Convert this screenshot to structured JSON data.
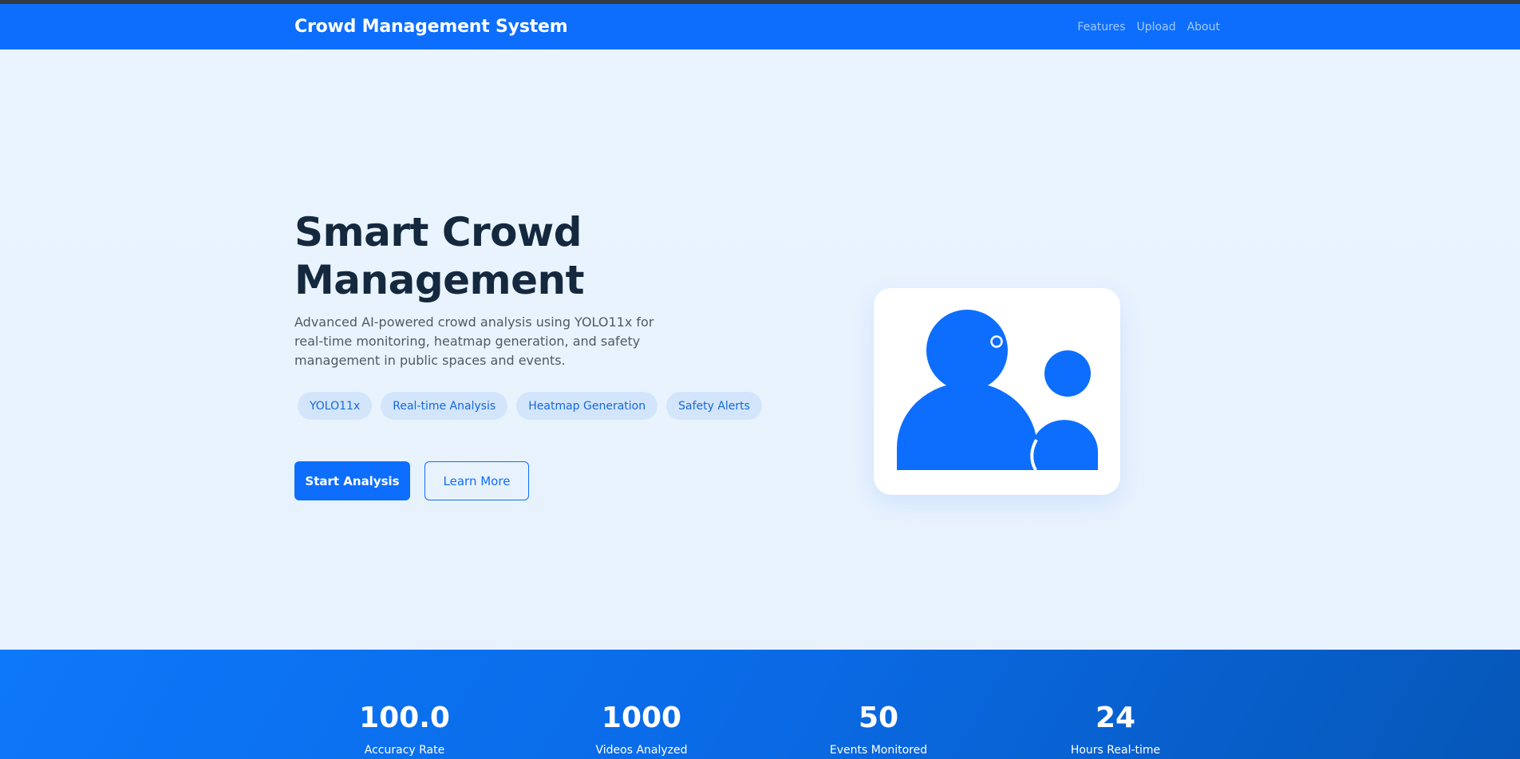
{
  "navbar": {
    "brand": "Crowd Management System",
    "links": [
      "Features",
      "Upload",
      "About"
    ]
  },
  "hero": {
    "title": "Smart Crowd Management",
    "description": "Advanced AI-powered crowd analysis using YOLO11x for real-time monitoring, heatmap generation, and safety management in public spaces and events.",
    "tags": [
      "YOLO11x",
      "Real-time Analysis",
      "Heatmap Generation",
      "Safety Alerts"
    ],
    "primary_button": "Start Analysis",
    "secondary_button": "Learn More",
    "illustration_icon": "people-group-icon"
  },
  "stats": [
    {
      "value": "100.0",
      "label": "Accuracy Rate"
    },
    {
      "value": "1000",
      "label": "Videos Analyzed"
    },
    {
      "value": "50",
      "label": "Events Monitored"
    },
    {
      "value": "24",
      "label": "Hours Real-time"
    }
  ],
  "colors": {
    "primary": "#0d6efd",
    "hero_bg": "#eaf4fd",
    "title": "#14283e",
    "tag_bg": "#d2e5fb"
  }
}
